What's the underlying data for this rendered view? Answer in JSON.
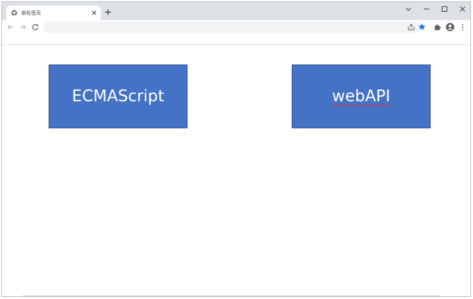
{
  "browser": {
    "tab": {
      "title": "新标签页",
      "favicon": "chrome-icon",
      "close_icon": "close-icon"
    },
    "new_tab_icon": "plus-icon",
    "window_controls": {
      "dropdown_icon": "chevron-down-icon",
      "minimize_icon": "minimize-icon",
      "maximize_icon": "maximize-icon",
      "close_icon": "close-icon"
    },
    "toolbar": {
      "back_icon": "arrow-left-icon",
      "forward_icon": "arrow-right-icon",
      "reload_icon": "reload-icon",
      "address_value": "",
      "address_placeholder": "",
      "share_icon": "share-icon",
      "bookmark_icon": "star-icon",
      "extensions_icon": "puzzle-icon",
      "profile_icon": "avatar-icon",
      "menu_icon": "kebab-menu-icon"
    },
    "colors": {
      "tabstrip_bg": "#dee1e6",
      "bookmark_star": "#1a73e8"
    }
  },
  "content": {
    "boxes": [
      {
        "label": "ECMAScript",
        "color": "#4472c4",
        "spellcheck_underline": false
      },
      {
        "label": "webAPI",
        "color": "#4472c4",
        "spellcheck_underline": true
      }
    ]
  }
}
